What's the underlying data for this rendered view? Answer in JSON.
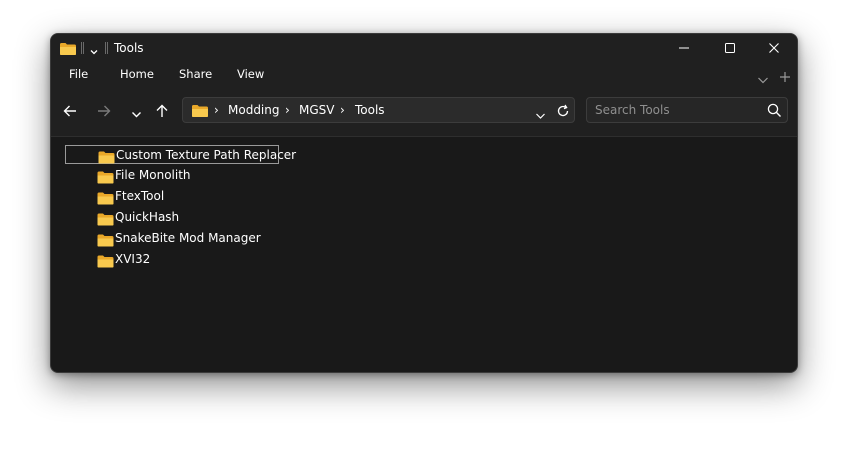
{
  "window": {
    "title": "Tools"
  },
  "menu": {
    "items": [
      "File",
      "Home",
      "Share",
      "View"
    ]
  },
  "address": {
    "crumbs": [
      "Modding",
      "MGSV",
      "Tools"
    ],
    "separator": "›"
  },
  "search": {
    "placeholder": "Search Tools",
    "value": ""
  },
  "files": [
    {
      "name": "Custom Texture Path Replacer",
      "selected": true
    },
    {
      "name": "File Monolith",
      "selected": false
    },
    {
      "name": "FtexTool",
      "selected": false
    },
    {
      "name": "QuickHash",
      "selected": false
    },
    {
      "name": "SnakeBite Mod Manager",
      "selected": false
    },
    {
      "name": "XVI32",
      "selected": false
    }
  ],
  "icons": {
    "folder": "folder-icon",
    "back": "arrow-left-icon",
    "forward": "arrow-right-icon",
    "recent": "chevron-down-icon",
    "up": "arrow-up-icon",
    "refresh": "refresh-icon",
    "search": "search-icon"
  },
  "colors": {
    "window_bg": "#191919",
    "chrome_bg": "#202020",
    "folder_yellow": "#f6c141",
    "text": "#ffffff",
    "placeholder": "#8f8f8f"
  }
}
